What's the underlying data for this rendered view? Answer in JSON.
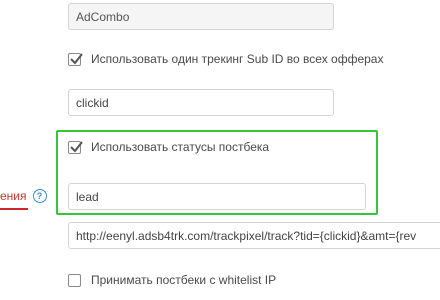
{
  "fields": {
    "source_name": "AdCombo",
    "subid_param": "clickid",
    "status_value": "lead",
    "postback_url": "http://eenyl.adsb4trk.com/trackpixel/track?tid={clickid}&amt={rev"
  },
  "checks": {
    "single_subid": {
      "label": "Использовать один трекинг Sub ID во всех офферах",
      "checked": true
    },
    "use_statuses": {
      "label": "Использовать статусы постбека",
      "checked": true
    },
    "whitelist": {
      "label": "Принимать постбеки с whitelist IP",
      "checked": false
    }
  },
  "side_label": "ения",
  "help_icon_glyph": "?",
  "colors": {
    "highlight": "#37c53b",
    "underline": "#d02828",
    "help": "#3a8fd6"
  }
}
